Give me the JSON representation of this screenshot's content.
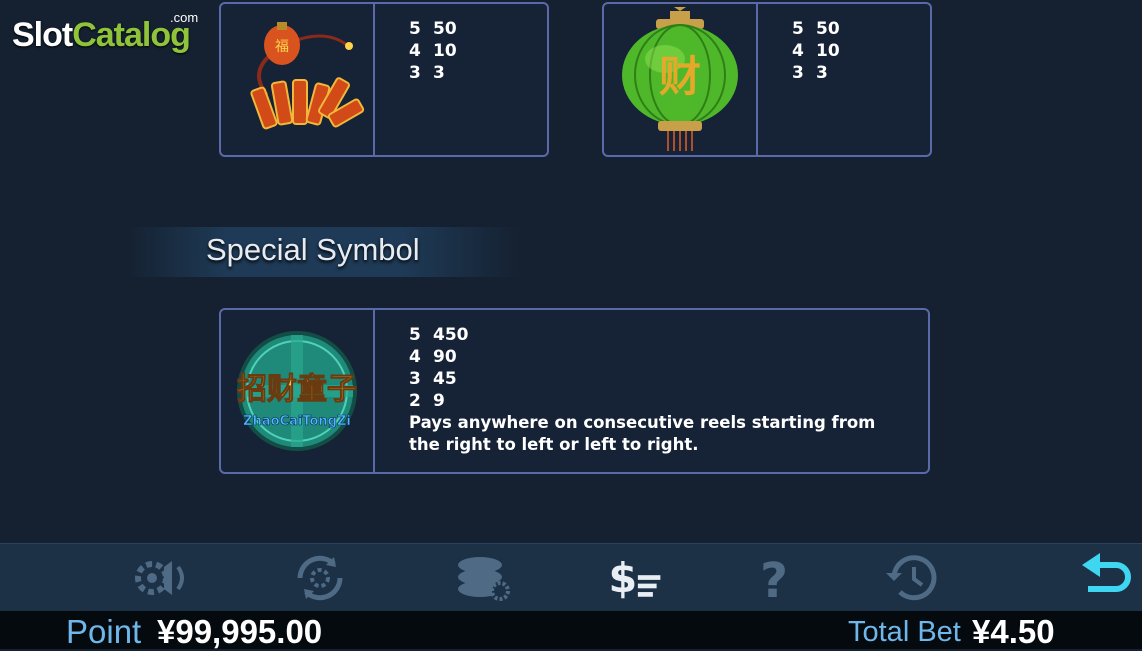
{
  "logo": {
    "slot": "Slot",
    "catalog": "Catalog",
    "com": ".com"
  },
  "symbols": [
    {
      "name": "firecracker-symbol",
      "pays": [
        [
          "5",
          "50"
        ],
        [
          "4",
          "10"
        ],
        [
          "3",
          "3"
        ]
      ]
    },
    {
      "name": "lantern-symbol",
      "pays": [
        [
          "5",
          "50"
        ],
        [
          "4",
          "10"
        ],
        [
          "3",
          "3"
        ]
      ],
      "glyph": "财"
    }
  ],
  "special": {
    "title": "Special Symbol",
    "symbol_text_cn": "招财童子",
    "symbol_text_en": "ZhaoCaiTongZi",
    "pays": [
      [
        "5",
        "450"
      ],
      [
        "4",
        "90"
      ],
      [
        "3",
        "45"
      ],
      [
        "2",
        "9"
      ]
    ],
    "description": "Pays anywhere on consecutive reels starting from the right to left or left to right."
  },
  "toolbar": {
    "icons": [
      "sound-settings-icon",
      "autoplay-settings-icon",
      "chips-settings-icon",
      "paytable-icon",
      "help-icon",
      "history-icon",
      "back-icon"
    ]
  },
  "status": {
    "point_label": "Point",
    "point_value": "¥99,995.00",
    "bet_label": "Total Bet",
    "bet_value": "¥4.50"
  },
  "colors": {
    "card_border": "#5a6aa8",
    "label_blue": "#6fb7ea",
    "accent_cyan": "#3fd6f2"
  }
}
